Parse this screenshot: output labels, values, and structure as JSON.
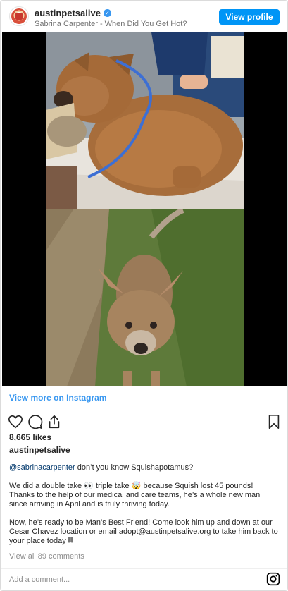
{
  "header": {
    "username": "austinpetsalive",
    "subtitle": "Sabrina Carpenter - When Did You Get Hot?",
    "view_profile_label": "View profile"
  },
  "view_more_label": "View more on Instagram",
  "likes": "8,665 likes",
  "owner": "austinpetsalive",
  "caption": {
    "mention": "@sabrinacarpenter",
    "line1_rest": " don’t you know Squishapotamus?",
    "para2": "We did a double take 👀 triple take 🤯 because Squish lost 45 pounds! Thanks to the help of our medical and care teams, he’s a whole new man since arriving in April and is truly thriving today.",
    "para3": "Now, he’s ready to be Man’s Best Friend! Come look him up and down at our Cesar Chavez location or email adopt@austinpetsalive.org to take him back to your place today 𝄜"
  },
  "view_comments": "View all 89 comments",
  "add_comment_placeholder": "Add a comment...",
  "colors": {
    "accent": "#0095f6",
    "link": "#3897f0",
    "muted": "#8e8e8e"
  },
  "icons": [
    "verified-badge-icon",
    "heart-icon",
    "comment-icon",
    "share-icon",
    "bookmark-icon",
    "instagram-icon"
  ]
}
